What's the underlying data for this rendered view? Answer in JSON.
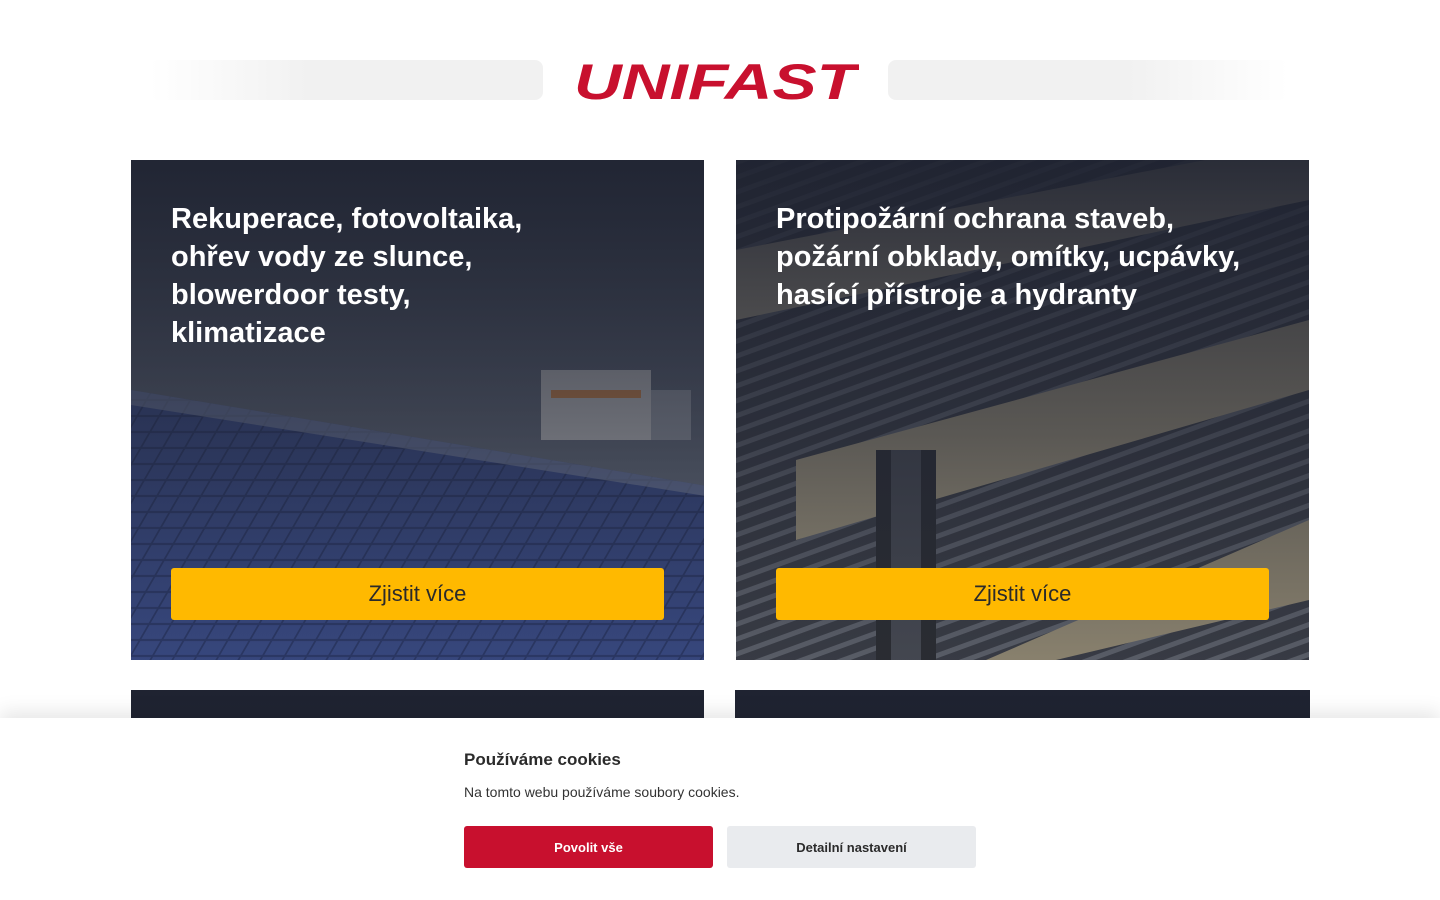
{
  "brand": {
    "logo_text": "UNIFAST",
    "logo_color": "#c8102e"
  },
  "cards": [
    {
      "title": "Rekuperace, fotovoltaika, ohřev vody ze slunce, blowerdoor testy, klimatizace",
      "button_label": "Zjistit více",
      "image": "solar-panels"
    },
    {
      "title": "Protipožární ochrana staveb, požární obklady, omítky, ucpávky, hasící přístroje a hydranty",
      "button_label": "Zjistit více",
      "image": "steel-beams"
    }
  ],
  "cookie_banner": {
    "title": "Používáme cookies",
    "text": "Na tomto webu používáme soubory cookies.",
    "accept_label": "Povolit vše",
    "settings_label": "Detailní nastavení"
  },
  "colors": {
    "accent": "#c8102e",
    "button_yellow": "#ffb900",
    "card_dark": "#2a2f3e",
    "secondary_button": "#e9ebee"
  }
}
